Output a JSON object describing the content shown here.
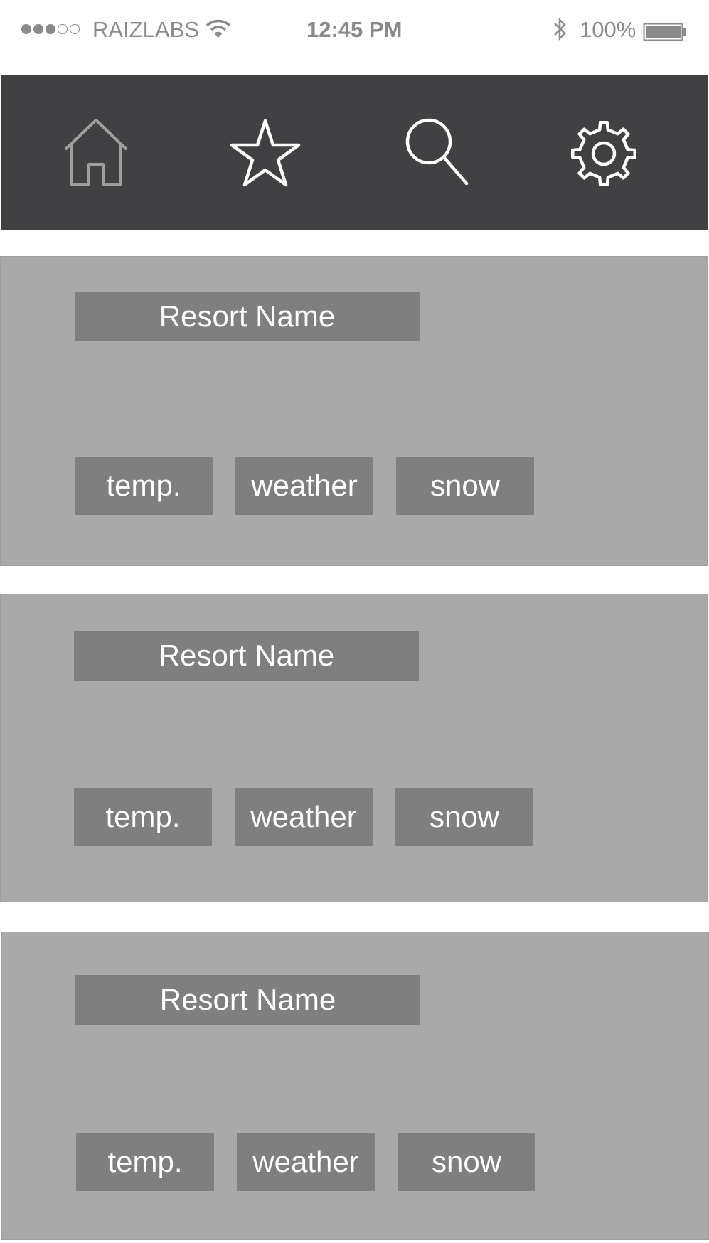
{
  "status_bar": {
    "carrier": "RAIZLABS",
    "time": "12:45 PM",
    "battery": "100%"
  },
  "navbar": {
    "icons": [
      "home-icon",
      "star-icon",
      "search-icon",
      "gear-icon"
    ]
  },
  "cards": [
    {
      "title": "Resort Name",
      "chips": [
        "temp.",
        "weather",
        "snow"
      ]
    },
    {
      "title": "Resort Name",
      "chips": [
        "temp.",
        "weather",
        "snow"
      ]
    },
    {
      "title": "Resort Name",
      "chips": [
        "temp.",
        "weather",
        "snow"
      ]
    }
  ],
  "colors": {
    "navbar_bg": "#414143",
    "card_bg": "#a9a9a9",
    "box_bg": "#7f7f7f",
    "text_light": "#ffffff"
  }
}
